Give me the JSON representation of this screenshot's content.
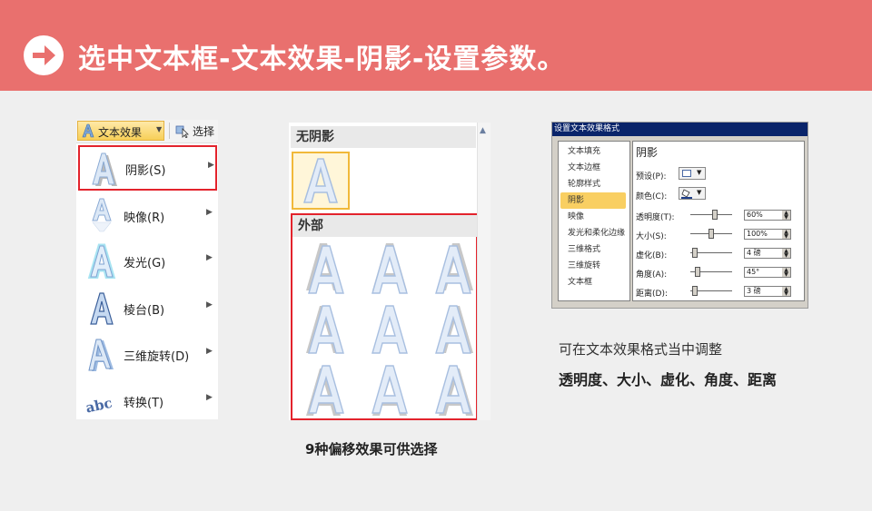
{
  "header": {
    "title": "选中文本框-文本效果-阴影-设置参数。",
    "bg_color": "#e9706e",
    "icon": "arrow-right-circle-icon"
  },
  "menu": {
    "toolbar": {
      "text_effect_label": "文本效果",
      "select_label": "选择"
    },
    "items": [
      {
        "label": "阴影(S)",
        "icon": "shadow-a-icon",
        "highlighted": true
      },
      {
        "label": "映像(R)",
        "icon": "reflection-a-icon"
      },
      {
        "label": "发光(G)",
        "icon": "glow-a-icon"
      },
      {
        "label": "棱台(B)",
        "icon": "bevel-a-icon"
      },
      {
        "label": "三维旋转(D)",
        "icon": "3d-rotation-a-icon"
      },
      {
        "label": "转换(T)",
        "icon": "transform-abc-icon"
      }
    ]
  },
  "gallery": {
    "no_shadow_label": "无阴影",
    "outer_label": "外部",
    "caption": "9种偏移效果可供选择"
  },
  "dialog": {
    "title": "设置文本效果格式",
    "nav": [
      "文本填充",
      "文本边框",
      "轮廓样式",
      "阴影",
      "映像",
      "发光和柔化边缘",
      "三维格式",
      "三维旋转",
      "文本框"
    ],
    "selected_nav": "阴影",
    "heading": "阴影",
    "preset_label": "预设(P):",
    "color_label": "颜色(C):",
    "params": [
      {
        "label": "透明度(T):",
        "value": "60%",
        "level": 0.6
      },
      {
        "label": "大小(S):",
        "value": "100%",
        "level": 0.5
      },
      {
        "label": "虚化(B):",
        "value": "4 磅",
        "level": 0.05
      },
      {
        "label": "角度(A):",
        "value": "45°",
        "level": 0.12
      },
      {
        "label": "距离(D):",
        "value": "3 磅",
        "level": 0.05
      }
    ]
  },
  "captions": {
    "right_line1": "可在文本效果格式当中调整",
    "right_line2": "透明度、大小、虚化、角度、距离"
  }
}
